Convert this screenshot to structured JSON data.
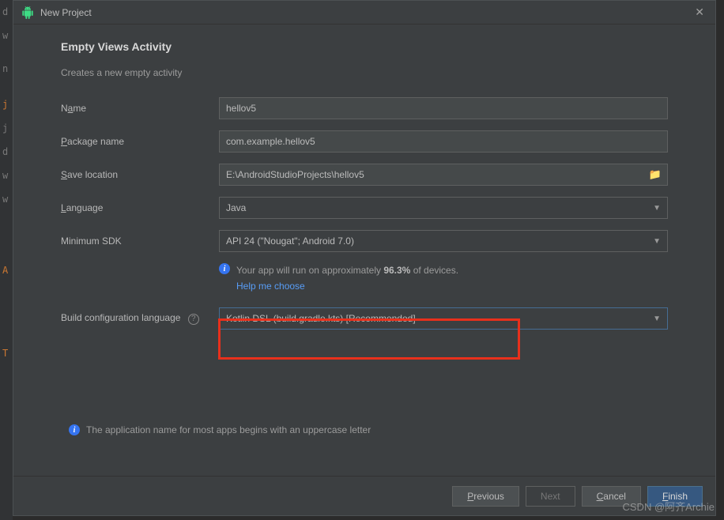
{
  "titlebar": {
    "title": "New Project"
  },
  "heading": "Empty Views Activity",
  "subheading": "Creates a new empty activity",
  "fields": {
    "name": {
      "label_pre": "N",
      "label_u": "a",
      "label_post": "me",
      "value": "hellov5"
    },
    "package": {
      "label_pre": "",
      "label_u": "P",
      "label_post": "ackage name",
      "value": "com.example.hellov5"
    },
    "save": {
      "label_pre": "",
      "label_u": "S",
      "label_post": "ave location",
      "value": "E:\\AndroidStudioProjects\\hellov5"
    },
    "language": {
      "label_pre": "",
      "label_u": "L",
      "label_post": "anguage",
      "value": "Java"
    },
    "minsdk": {
      "label": "Minimum SDK",
      "value": "API 24 (\"Nougat\"; Android 7.0)"
    },
    "buildconf": {
      "label": "Build configuration language",
      "value": "Kotlin DSL (build.gradle.kts) [Recommended]"
    }
  },
  "info": {
    "devices_pre": "Your app will run on approximately ",
    "devices_pct": "96.3%",
    "devices_post": " of devices.",
    "help_link": "Help me choose"
  },
  "bottom_info": "The application name for most apps begins with an uppercase letter",
  "buttons": {
    "previous_u": "P",
    "previous_post": "revious",
    "next": "Next",
    "cancel_u": "C",
    "cancel_post": "ancel",
    "finish_u": "F",
    "finish_post": "inish"
  },
  "watermark": "CSDN @阿齐Archie",
  "bg_chars": [
    "d",
    "w",
    "n",
    "j",
    "j",
    "d",
    "w",
    "w",
    "A",
    "T"
  ]
}
